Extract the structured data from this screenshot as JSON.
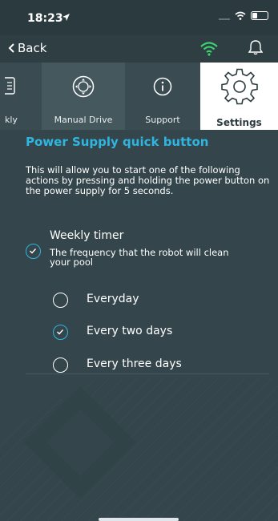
{
  "status": {
    "time": "18:23"
  },
  "nav": {
    "back_label": "Back"
  },
  "tabs": [
    {
      "label": "kly"
    },
    {
      "label": "Manual Drive"
    },
    {
      "label": "Support"
    },
    {
      "label": "Settings"
    }
  ],
  "page": {
    "title": "Power Supply quick button",
    "description": "This will allow you to start one of the following actions by pressing and holding the power button on the power supply for 5 seconds."
  },
  "weekly_timer": {
    "title": "Weekly timer",
    "description": "The frequency that the robot will clean your pool",
    "checked": true,
    "options": [
      {
        "label": "Everyday",
        "selected": false
      },
      {
        "label": "Every two days",
        "selected": true
      },
      {
        "label": "Every three days",
        "selected": false
      }
    ]
  },
  "colors": {
    "accent": "#2fb6e0",
    "wifi": "#3bd16f",
    "background": "#34464c"
  }
}
